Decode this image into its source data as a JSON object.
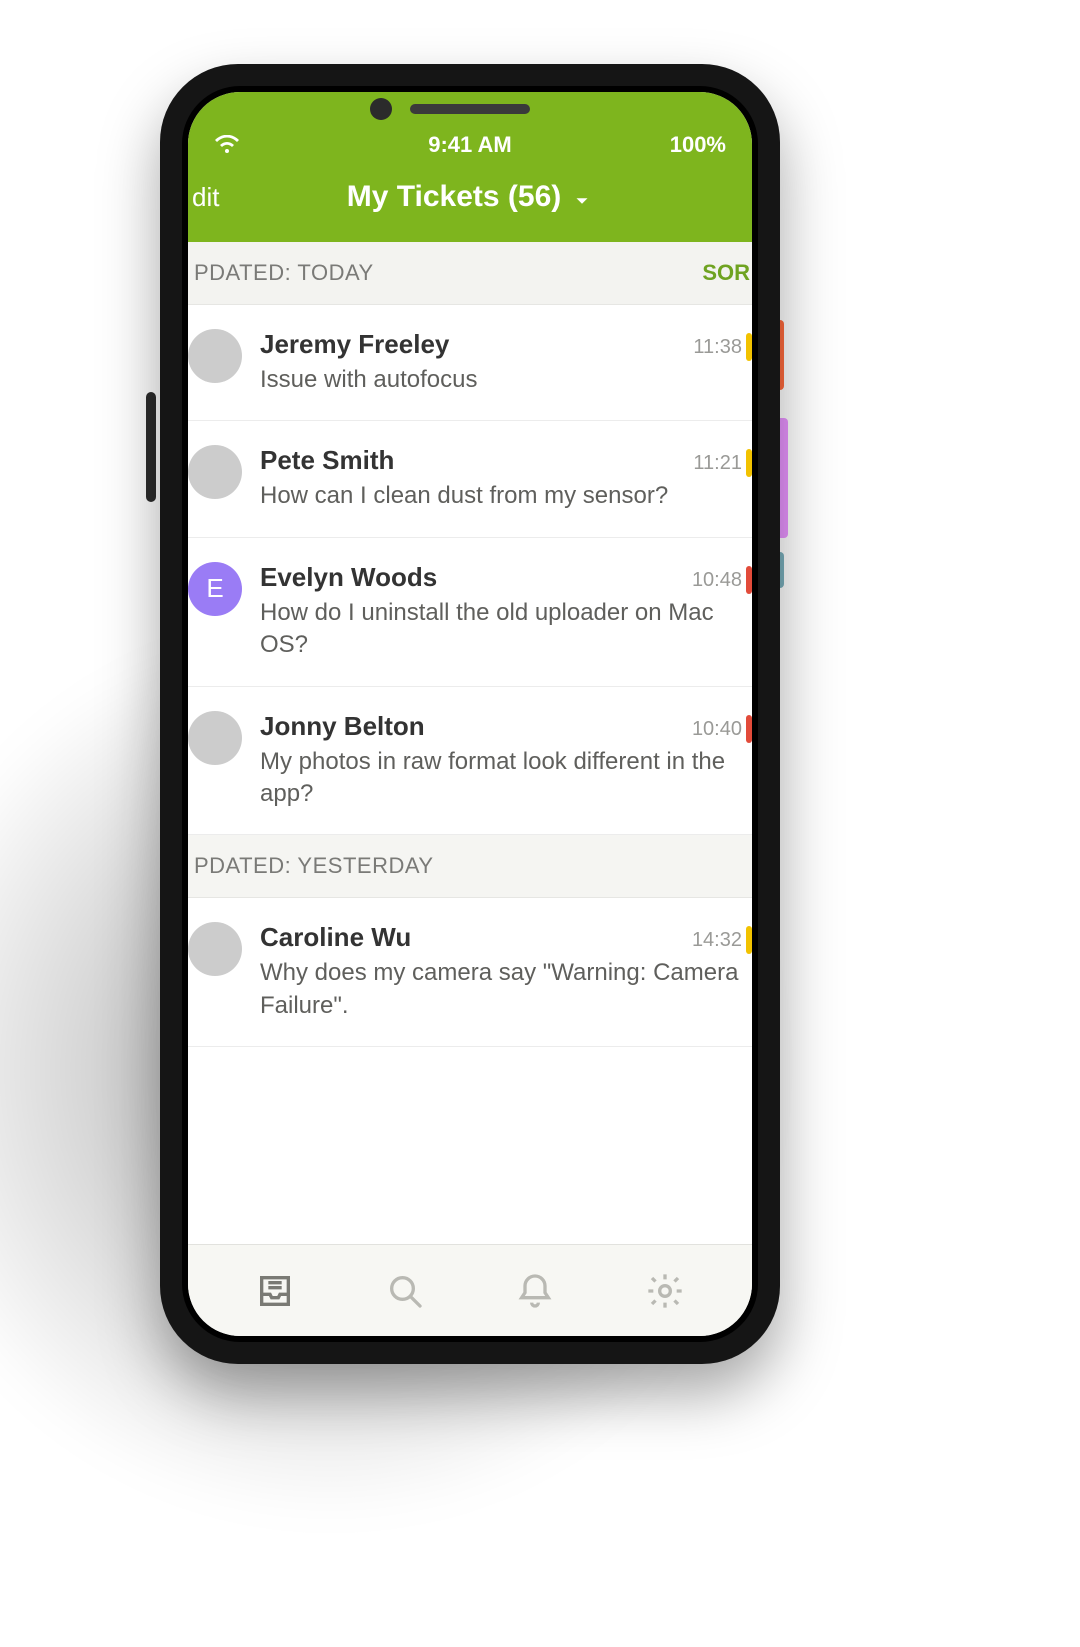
{
  "status": {
    "time": "9:41 AM",
    "battery": "100%"
  },
  "header": {
    "edit": "dit",
    "title": "My Tickets (56)",
    "sort": "SOR"
  },
  "sections": [
    {
      "label": "PDATED: TODAY"
    },
    {
      "label": "PDATED: YESTERDAY"
    }
  ],
  "tickets_today": [
    {
      "name": "Jeremy Freeley",
      "subject": "Issue with autofocus",
      "time": "11:38",
      "avatar_type": "photo",
      "avatar_class": "av-jf",
      "status_color": "#f2c200"
    },
    {
      "name": "Pete Smith",
      "subject": "How can I clean dust from my sensor?",
      "time": "11:21",
      "avatar_type": "photo",
      "avatar_class": "av-ps",
      "status_color": "#f2c200"
    },
    {
      "name": "Evelyn Woods",
      "subject": "How do I uninstall the old uploader on Mac OS?",
      "time": "10:48",
      "avatar_type": "letter",
      "avatar_letter": "E",
      "avatar_bg": "#9a7cf5",
      "status_color": "#e24b3a"
    },
    {
      "name": "Jonny Belton",
      "subject": "My photos in raw format look different in the app?",
      "time": "10:40",
      "avatar_type": "photo",
      "avatar_class": "av-jb",
      "status_color": "#e24b3a"
    }
  ],
  "tickets_yesterday": [
    {
      "name": "Caroline Wu",
      "subject": "Why does my camera say \"Warning: Camera Failure\".",
      "time": "14:32",
      "avatar_type": "photo",
      "avatar_class": "av-cw",
      "status_color": "#f2c200"
    }
  ],
  "tabs": {
    "inbox": "inbox",
    "search": "search",
    "notifications": "notifications",
    "settings": "settings"
  },
  "colors": {
    "brand_green": "#7EB51E"
  }
}
